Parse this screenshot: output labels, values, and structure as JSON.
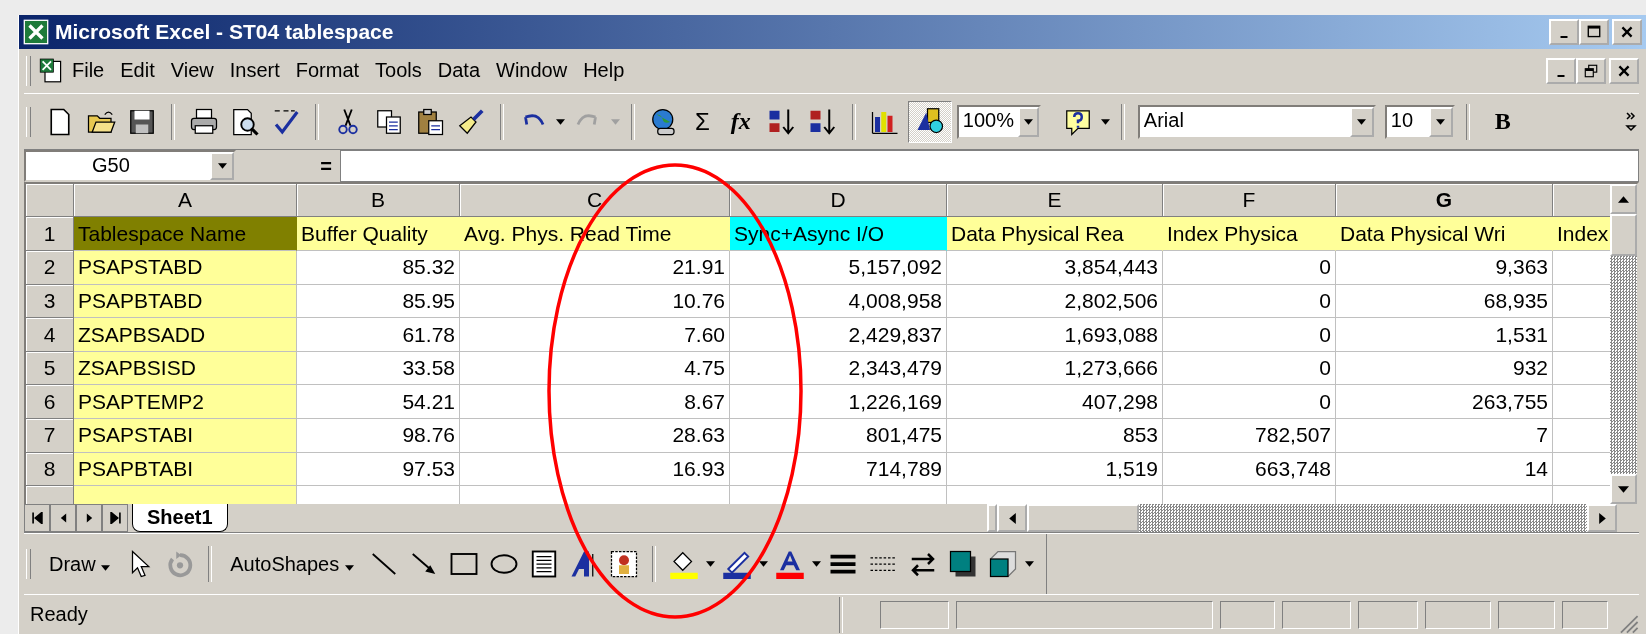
{
  "window": {
    "title": "Microsoft Excel - ST04 tablespace"
  },
  "menu_bar": {
    "items": [
      {
        "label": "File"
      },
      {
        "label": "Edit"
      },
      {
        "label": "View"
      },
      {
        "label": "Insert"
      },
      {
        "label": "Format"
      },
      {
        "label": "Tools"
      },
      {
        "label": "Data"
      },
      {
        "label": "Window"
      },
      {
        "label": "Help"
      }
    ]
  },
  "standard_toolbar": {
    "sum_symbol": "Σ",
    "function_symbol": "fx",
    "drawing_pressed": true,
    "zoom": "100%",
    "font": "Arial",
    "font_size": "10",
    "bold_label": "B"
  },
  "formula_bar": {
    "name_box": "G50",
    "equals": "="
  },
  "sheet": {
    "columns": [
      {
        "label": "A",
        "selected": false
      },
      {
        "label": "B",
        "selected": false
      },
      {
        "label": "C",
        "selected": false
      },
      {
        "label": "D",
        "selected": false
      },
      {
        "label": "E",
        "selected": false
      },
      {
        "label": "F",
        "selected": false
      },
      {
        "label": "G",
        "selected": true
      }
    ],
    "header_row": {
      "number": "1",
      "cells": [
        {
          "text": "Tablespace Name",
          "color": "#808000"
        },
        {
          "text": "Buffer Quality",
          "color": "#ffff99"
        },
        {
          "text": "Avg. Phys. Read Time",
          "color": "#ffff99"
        },
        {
          "text": "Sync+Async I/O",
          "color": "#00ffff"
        },
        {
          "text": "Data Physical Rea",
          "color": "#ffff99"
        },
        {
          "text": "Index Physica",
          "color": "#ffff99"
        },
        {
          "text": "Data Physical Wri",
          "color": "#ffff99"
        },
        {
          "text": "Index",
          "color": "#ffff99"
        }
      ]
    },
    "rows": [
      {
        "number": "2",
        "name": "PSAPSTABD",
        "color": "#ffff99",
        "values": [
          "85.32",
          "21.91",
          "5,157,092",
          "3,854,443",
          "0",
          "9,363"
        ]
      },
      {
        "number": "3",
        "name": "PSAPBTABD",
        "color": "#ffff99",
        "values": [
          "85.95",
          "10.76",
          "4,008,958",
          "2,802,506",
          "0",
          "68,935"
        ]
      },
      {
        "number": "4",
        "name": "ZSAPBSADD",
        "color": "#ffff99",
        "values": [
          "61.78",
          "7.60",
          "2,429,837",
          "1,693,088",
          "0",
          "1,531"
        ]
      },
      {
        "number": "5",
        "name": "ZSAPBSISD",
        "color": "#ffff99",
        "values": [
          "33.58",
          "4.75",
          "2,343,479",
          "1,273,666",
          "0",
          "932"
        ]
      },
      {
        "number": "6",
        "name": "PSAPTEMP2",
        "color": "#ffff99",
        "values": [
          "54.21",
          "8.67",
          "1,226,169",
          "407,298",
          "0",
          "263,755"
        ]
      },
      {
        "number": "7",
        "name": "PSAPSTABI",
        "color": "#ffff99",
        "values": [
          "98.76",
          "28.63",
          "801,475",
          "853",
          "782,507",
          "7"
        ]
      },
      {
        "number": "8",
        "name": "PSAPBTABI",
        "color": "#ffff99",
        "values": [
          "97.53",
          "16.93",
          "714,789",
          "1,519",
          "663,748",
          "14"
        ]
      }
    ]
  },
  "sheet_tabs": [
    {
      "label": "Sheet1",
      "selected": true
    }
  ],
  "drawing_toolbar": {
    "draw": {
      "label": "Draw"
    },
    "autoshapes": {
      "label": "AutoShapes"
    }
  },
  "status_bar": {
    "text": "Ready"
  }
}
